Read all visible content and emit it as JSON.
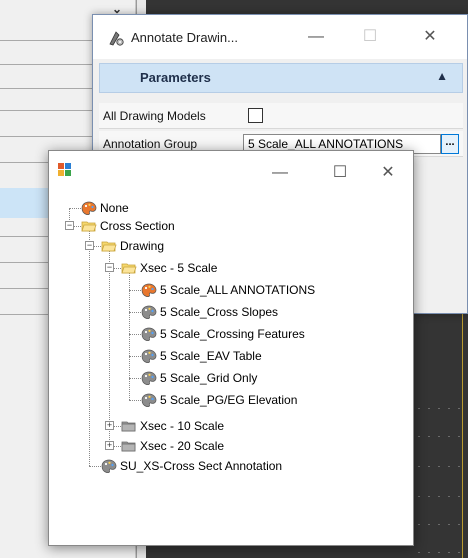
{
  "annotate_dialog": {
    "title": "Annotate Drawin...",
    "section_header": "Parameters",
    "fields": [
      {
        "label": "All Drawing Models",
        "type": "checkbox",
        "checked": false
      },
      {
        "label": "Annotation Group",
        "type": "browse",
        "value": "5 Scale_ALL ANNOTATIONS",
        "browse_label": "..."
      }
    ],
    "buttons": {
      "minimize": "—",
      "maximize": "☐",
      "close": "✕"
    }
  },
  "picker_dialog": {
    "buttons": {
      "minimize": "—",
      "maximize": "☐",
      "close": "✕"
    },
    "tree": [
      {
        "label": "None",
        "icon": "palette-orange-icon"
      },
      {
        "label": "Cross Section",
        "icon": "folder-open-icon",
        "expander": "−"
      },
      {
        "label": "Drawing",
        "icon": "folder-open-icon",
        "expander": "−"
      },
      {
        "label": "Xsec - 5 Scale",
        "icon": "folder-open-icon",
        "expander": "−"
      },
      {
        "label": "5 Scale_ALL ANNOTATIONS",
        "icon": "palette-orange-icon"
      },
      {
        "label": "5 Scale_Cross Slopes",
        "icon": "palette-gray-icon"
      },
      {
        "label": "5 Scale_Crossing Features",
        "icon": "palette-gray-icon"
      },
      {
        "label": "5 Scale_EAV Table",
        "icon": "palette-gray-icon"
      },
      {
        "label": "5 Scale_Grid Only",
        "icon": "palette-gray-icon"
      },
      {
        "label": "5 Scale_PG/EG Elevation",
        "icon": "palette-gray-icon"
      },
      {
        "label": "Xsec - 10 Scale",
        "icon": "folder-closed-icon",
        "expander": "+"
      },
      {
        "label": "Xsec - 20 Scale",
        "icon": "folder-closed-icon",
        "expander": "+"
      },
      {
        "label": "SU_XS-Cross Sect Annotation",
        "icon": "palette-gray-icon"
      }
    ]
  },
  "colors": {
    "header_blue": "#cfe3f5",
    "selection_blue": "#cce4f7",
    "folder_yellow": "#f5d76e",
    "palette_orange": "#e8772e",
    "palette_gray": "#8c8c8c"
  }
}
